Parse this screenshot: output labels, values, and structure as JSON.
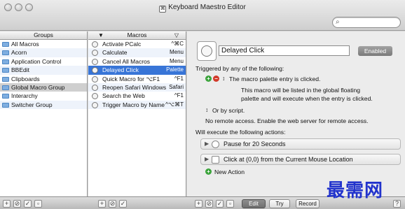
{
  "window": {
    "title": "Keyboard Maestro Editor"
  },
  "search": {
    "placeholder": ""
  },
  "groups": {
    "header": "Groups",
    "items": [
      {
        "label": "All Macros"
      },
      {
        "label": "Acorn"
      },
      {
        "label": "Application Control"
      },
      {
        "label": "BBEdit"
      },
      {
        "label": "Clipboards"
      },
      {
        "label": "Global Macro Group"
      },
      {
        "label": "Interarchy"
      },
      {
        "label": "Switcher Group"
      }
    ]
  },
  "macros": {
    "header": "Macros",
    "items": [
      {
        "label": "Activate PCalc",
        "hotkey": "^⌘C"
      },
      {
        "label": "Calculate",
        "hotkey": "Menu"
      },
      {
        "label": "Cancel All Macros",
        "hotkey": "Menu"
      },
      {
        "label": "Delayed Click",
        "hotkey": "Palette"
      },
      {
        "label": "Quick Macro for ⌥F1",
        "hotkey": "^F1"
      },
      {
        "label": "Reopen Safari Windows",
        "hotkey": "Safari"
      },
      {
        "label": "Search the Web",
        "hotkey": "^F1"
      },
      {
        "label": "Trigger Macro by Name",
        "hotkey": "^⌥⌘T"
      }
    ]
  },
  "editor": {
    "macro_name": "Delayed Click",
    "enabled_label": "Enabled",
    "triggered_label": "Triggered by any of the following:",
    "trigger_text": "The macro palette entry is clicked.",
    "trigger_desc_1": "This macro will be listed in the global floating",
    "trigger_desc_2": "palette and will execute when the entry is clicked.",
    "or_by_script": "Or by script.",
    "remote_access": "No remote access.  Enable the web server for remote access.",
    "actions_label": "Will execute the following actions:",
    "actions": [
      {
        "label": "Pause for 20 Seconds"
      },
      {
        "label": "Click at (0,0) from the Current Mouse Location"
      }
    ],
    "new_action": "New Action"
  },
  "bottombar": {
    "edit": "Edit",
    "try": "Try",
    "record": "Record"
  },
  "watermark": "最需网",
  "colors": {
    "selection": "#3875d7",
    "plus": "#3aa33a",
    "minus": "#d23a2a"
  }
}
